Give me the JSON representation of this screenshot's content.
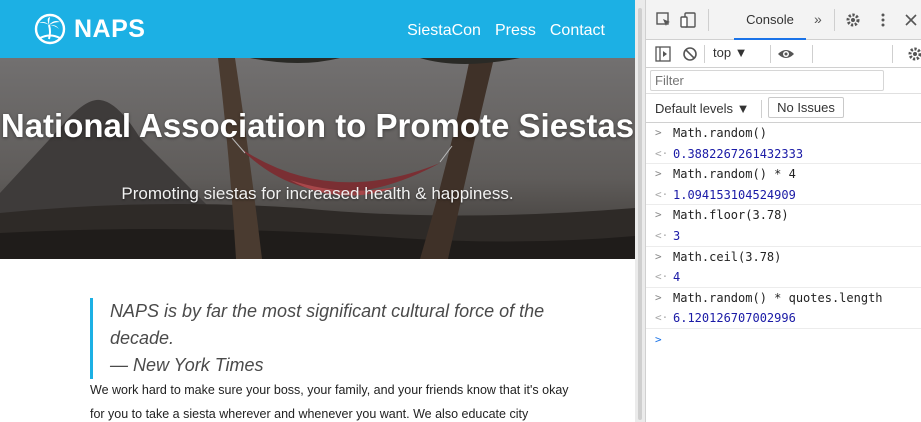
{
  "site": {
    "brand": "NAPS",
    "nav": [
      "SiestaCon",
      "Press",
      "Contact"
    ],
    "hero": {
      "title": "National Association to Promote Siestas",
      "subtitle": "Promoting siestas for increased health & happiness."
    },
    "quote": {
      "text": "NAPS is by far the most significant cultural force of the decade.",
      "attribution": "— New York Times"
    },
    "body": "We work hard to make sure your boss, your family, and your friends know that it's okay for you to take a siesta wherever and whenever you want. We also educate city",
    "colors": {
      "header": "#1cb0e4",
      "quote_border": "#1cb0e4"
    }
  },
  "devtools": {
    "tabs": {
      "active": "Console",
      "more": "»"
    },
    "icons": [
      "inspect-icon",
      "device-toggle-icon",
      "settings-icon",
      "more-menu-icon",
      "close-icon",
      "sidebar-toggle-icon",
      "clear-console-icon",
      "eye-icon"
    ],
    "context": "top ▼",
    "filter_placeholder": "Filter",
    "levels": "Default levels ▼",
    "issues": "No Issues",
    "console": [
      {
        "input": "Math.random()",
        "output": "0.3882267261432333"
      },
      {
        "input": "Math.random() * 4",
        "output": "1.094153104524909"
      },
      {
        "input": "Math.floor(3.78)",
        "output": "3"
      },
      {
        "input": "Math.ceil(3.78)",
        "output": "4"
      },
      {
        "input": "Math.random() * quotes.length",
        "output": "6.120126707002996"
      }
    ],
    "colors": {
      "accent": "#1a73e8",
      "output": "#1a1aa6"
    }
  }
}
